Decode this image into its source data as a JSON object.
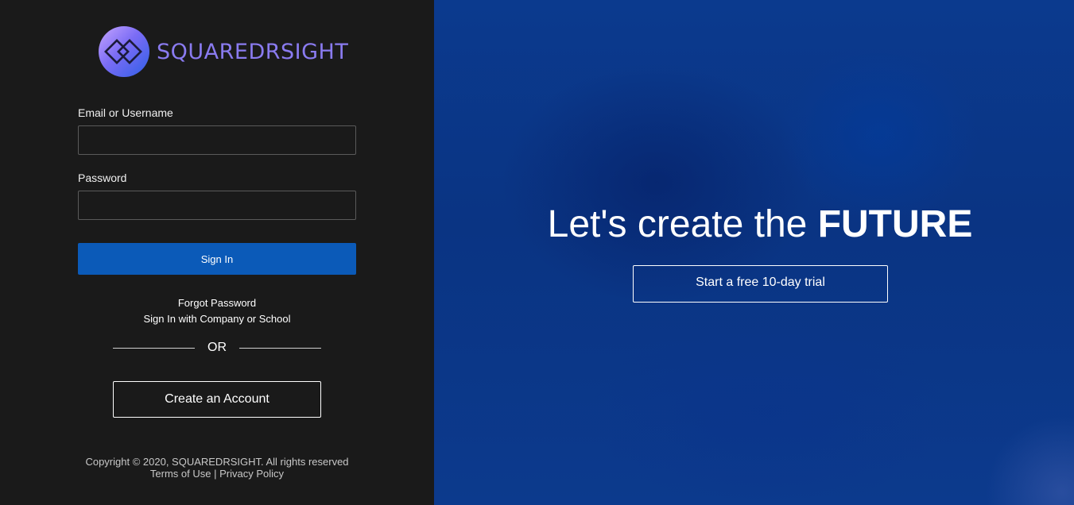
{
  "brand": {
    "name": "SQUAREDRSIGHT",
    "logo_icon": "diamond-squares-icon",
    "colors": {
      "text": "#8a7bf0",
      "badge_from": "#c7a6ff",
      "badge_to": "#2f5fe6"
    }
  },
  "login_form": {
    "email_label": "Email or Username",
    "email_value": "",
    "email_placeholder": "",
    "password_label": "Password",
    "password_value": "",
    "password_placeholder": "",
    "signin_label": "Sign In",
    "forgot_password": "Forgot Password",
    "sign_in_org": "Sign In with Company or School",
    "or_text": "OR",
    "create_account": "Create an Account"
  },
  "footer": {
    "copyright": "Copyright © 2020, SQUAREDRSIGHT. All rights reserved",
    "terms": "Terms of Use",
    "separator": "|",
    "privacy": "Privacy Policy"
  },
  "hero": {
    "headline_prefix": "Let's create the ",
    "headline_emphasis": "FUTURE",
    "trial_button": "Start a free 10-day trial"
  },
  "colors": {
    "left_panel_bg": "#1a1a1a",
    "primary_button": "#0b5ab8",
    "hero_bg": "#0a3483"
  }
}
